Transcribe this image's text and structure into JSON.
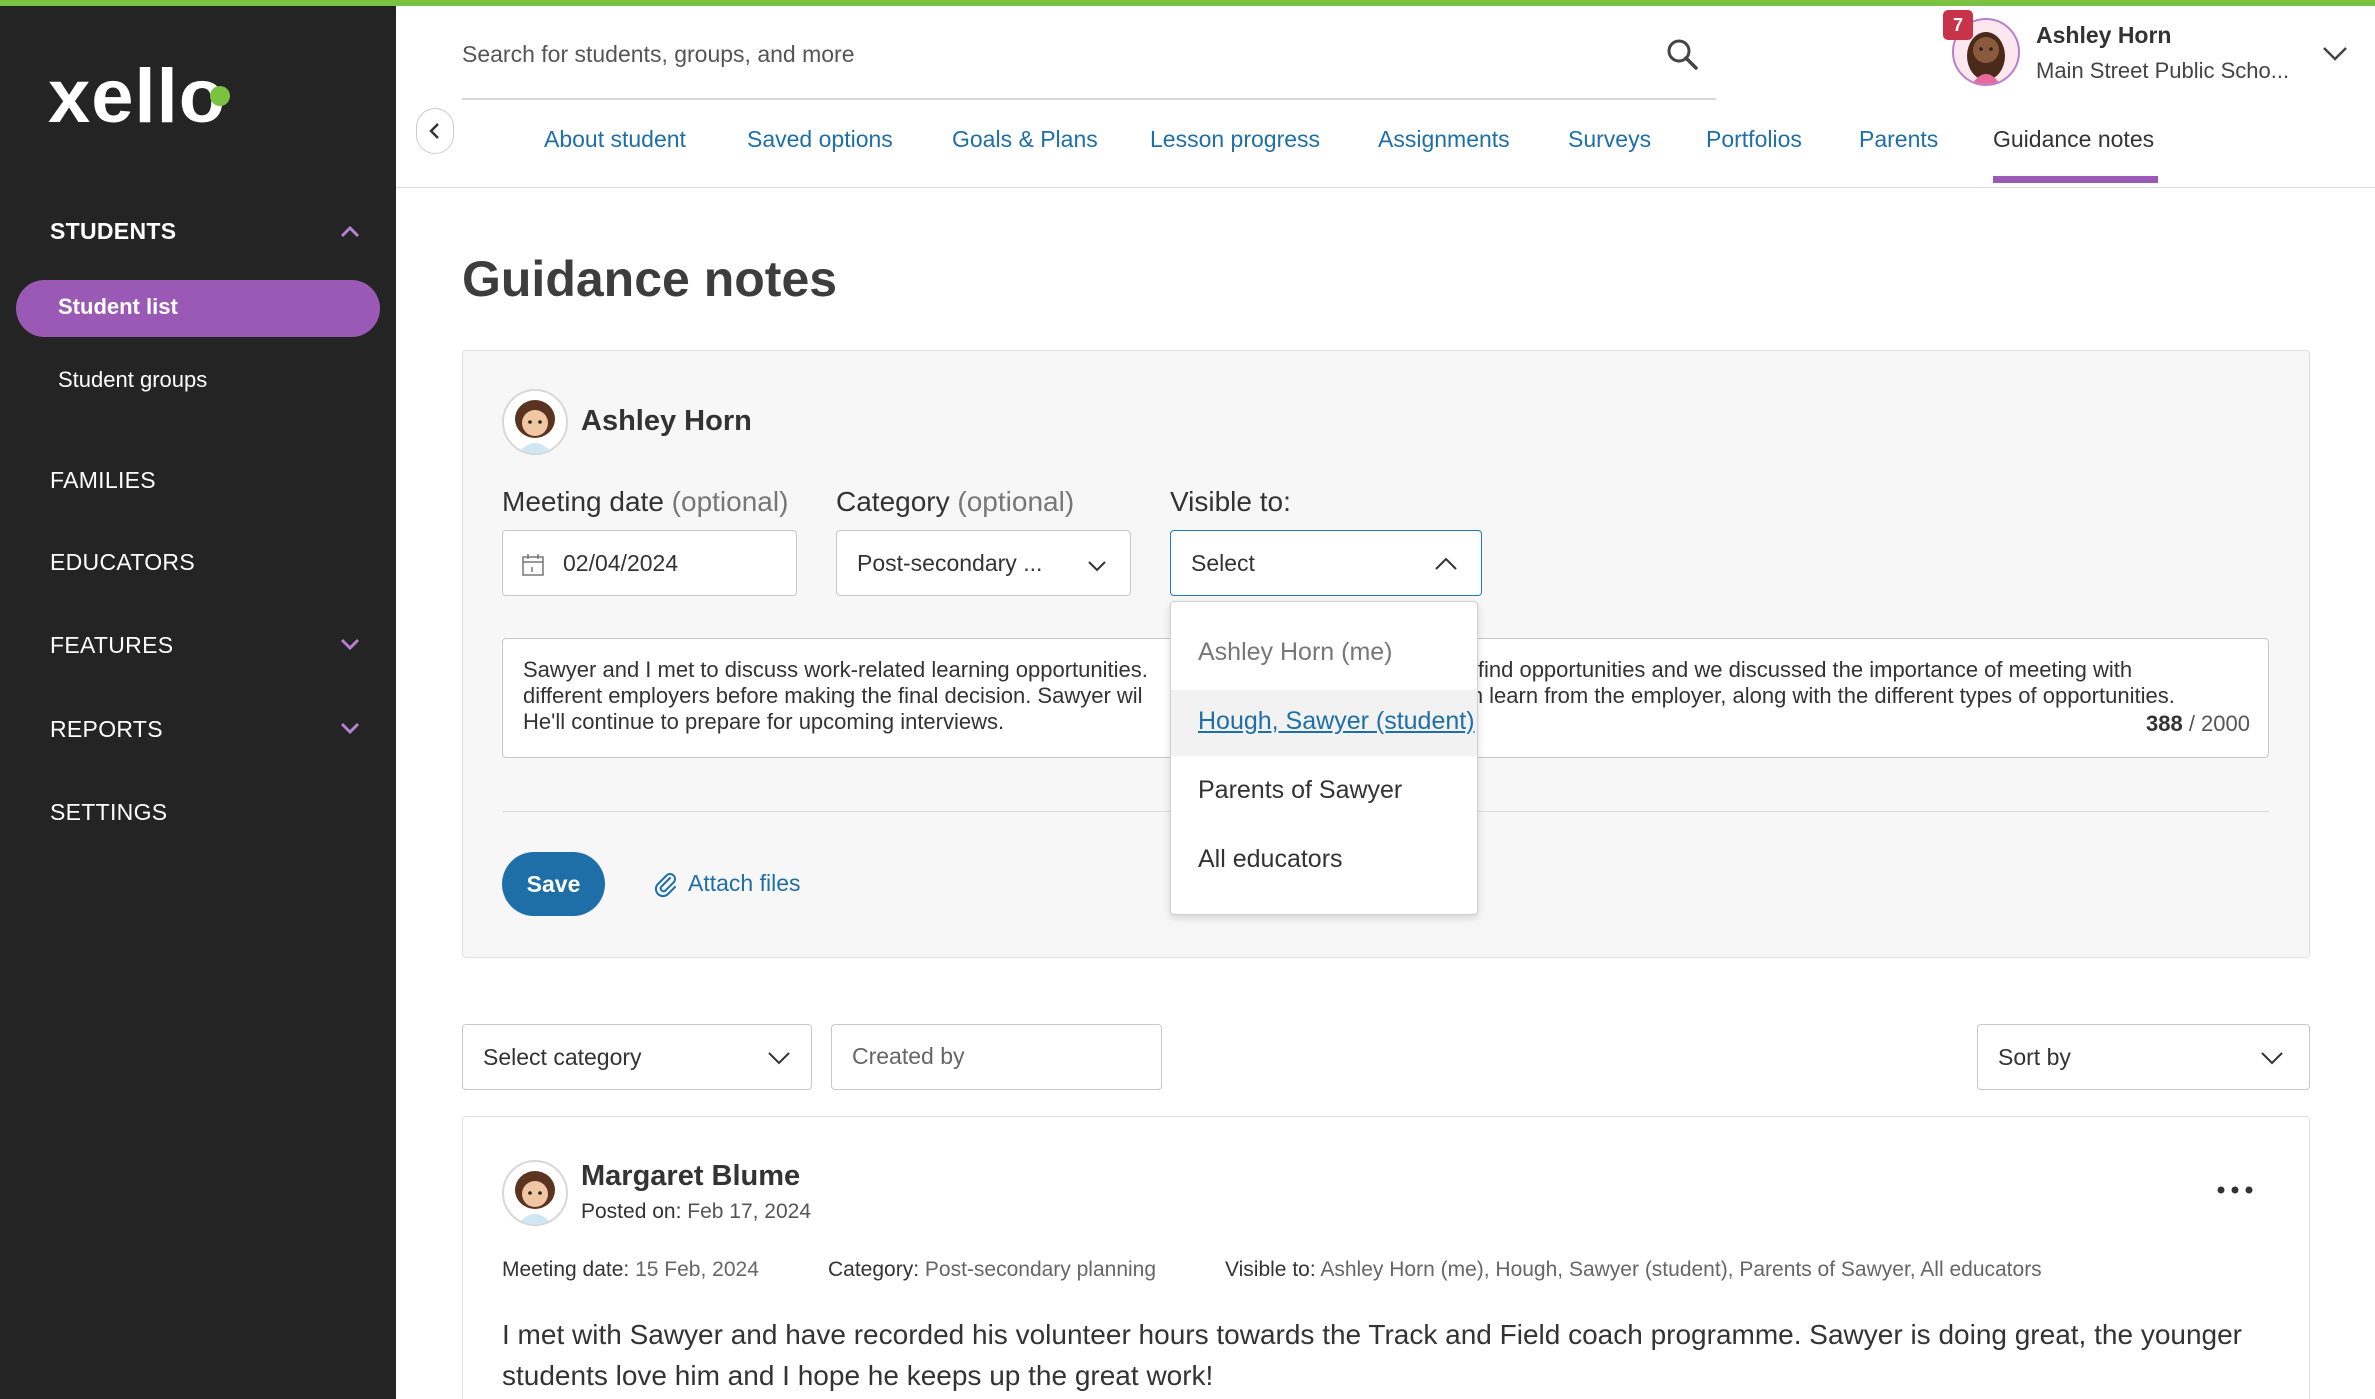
{
  "app": {
    "brand": "xello",
    "accent_color": "#9b59b6",
    "link_color": "#1e6fa8",
    "top_bar_color": "#7cc242"
  },
  "sidebar": {
    "sections": [
      {
        "label": "STUDENTS",
        "expanded": true
      },
      {
        "label": "FAMILIES"
      },
      {
        "label": "EDUCATORS"
      },
      {
        "label": "FEATURES",
        "expandable": true
      },
      {
        "label": "REPORTS",
        "expandable": true
      },
      {
        "label": "SETTINGS"
      }
    ],
    "student_items": [
      {
        "label": "Student list",
        "active": true
      },
      {
        "label": "Student groups"
      }
    ]
  },
  "search": {
    "placeholder": "Search for students, groups, and more"
  },
  "user": {
    "name": "Ashley Horn",
    "school": "Main Street Public Scho...",
    "notification_count": "7"
  },
  "tabs": [
    {
      "label": "About student"
    },
    {
      "label": "Saved options"
    },
    {
      "label": "Goals & Plans"
    },
    {
      "label": "Lesson progress"
    },
    {
      "label": "Assignments"
    },
    {
      "label": "Surveys"
    },
    {
      "label": "Portfolios"
    },
    {
      "label": "Parents"
    },
    {
      "label": "Guidance notes",
      "active": true
    }
  ],
  "page": {
    "title": "Guidance notes"
  },
  "form": {
    "author": "Ashley Horn",
    "meeting_date_label": "Meeting date",
    "optional": "(optional)",
    "meeting_date_value": "02/04/2024",
    "category_label": "Category",
    "category_value": "Post-secondary ...",
    "visible_label": "Visible to:",
    "visible_value": "Select",
    "note_left_1": "Sawyer and I met to discuss work-related learning opportunities.",
    "note_right_1": "find opportunities and we discussed the importance of meeting with",
    "note_left_2": "different employers before making the final decision. Sawyer wil",
    "note_right_2": "can learn from the employer, along with the different types of opportunities.",
    "note_line_3": "He'll continue to prepare for upcoming interviews.",
    "char_count": "388",
    "char_sep": " / ",
    "char_max": "2000",
    "save_label": "Save",
    "attach_label": "Attach files"
  },
  "visible_dropdown": {
    "options": [
      {
        "label": "Ashley Horn (me)",
        "state": "disabled"
      },
      {
        "label": "Hough, Sawyer (student)",
        "state": "hover"
      },
      {
        "label": "Parents of Sawyer"
      },
      {
        "label": "All educators"
      }
    ]
  },
  "filters": {
    "category": "Select category",
    "created_by_placeholder": "Created by",
    "sort": "Sort by"
  },
  "notes": [
    {
      "author": "Margaret Blume",
      "posted_label": "Posted on:",
      "posted_value": "Feb 17, 2024",
      "meeting_label": "Meeting date:",
      "meeting_value": "15 Feb, 2024",
      "category_label": "Category:",
      "category_value": "Post-secondary planning",
      "visible_label": "Visible to:",
      "visible_value": "Ashley Horn (me), Hough, Sawyer (student), Parents of Sawyer, All educators",
      "body": "I met with Sawyer and have recorded his volunteer hours towards the Track and Field coach programme. Sawyer is doing great, the younger students love him and I hope he keeps up the great work!"
    }
  ]
}
